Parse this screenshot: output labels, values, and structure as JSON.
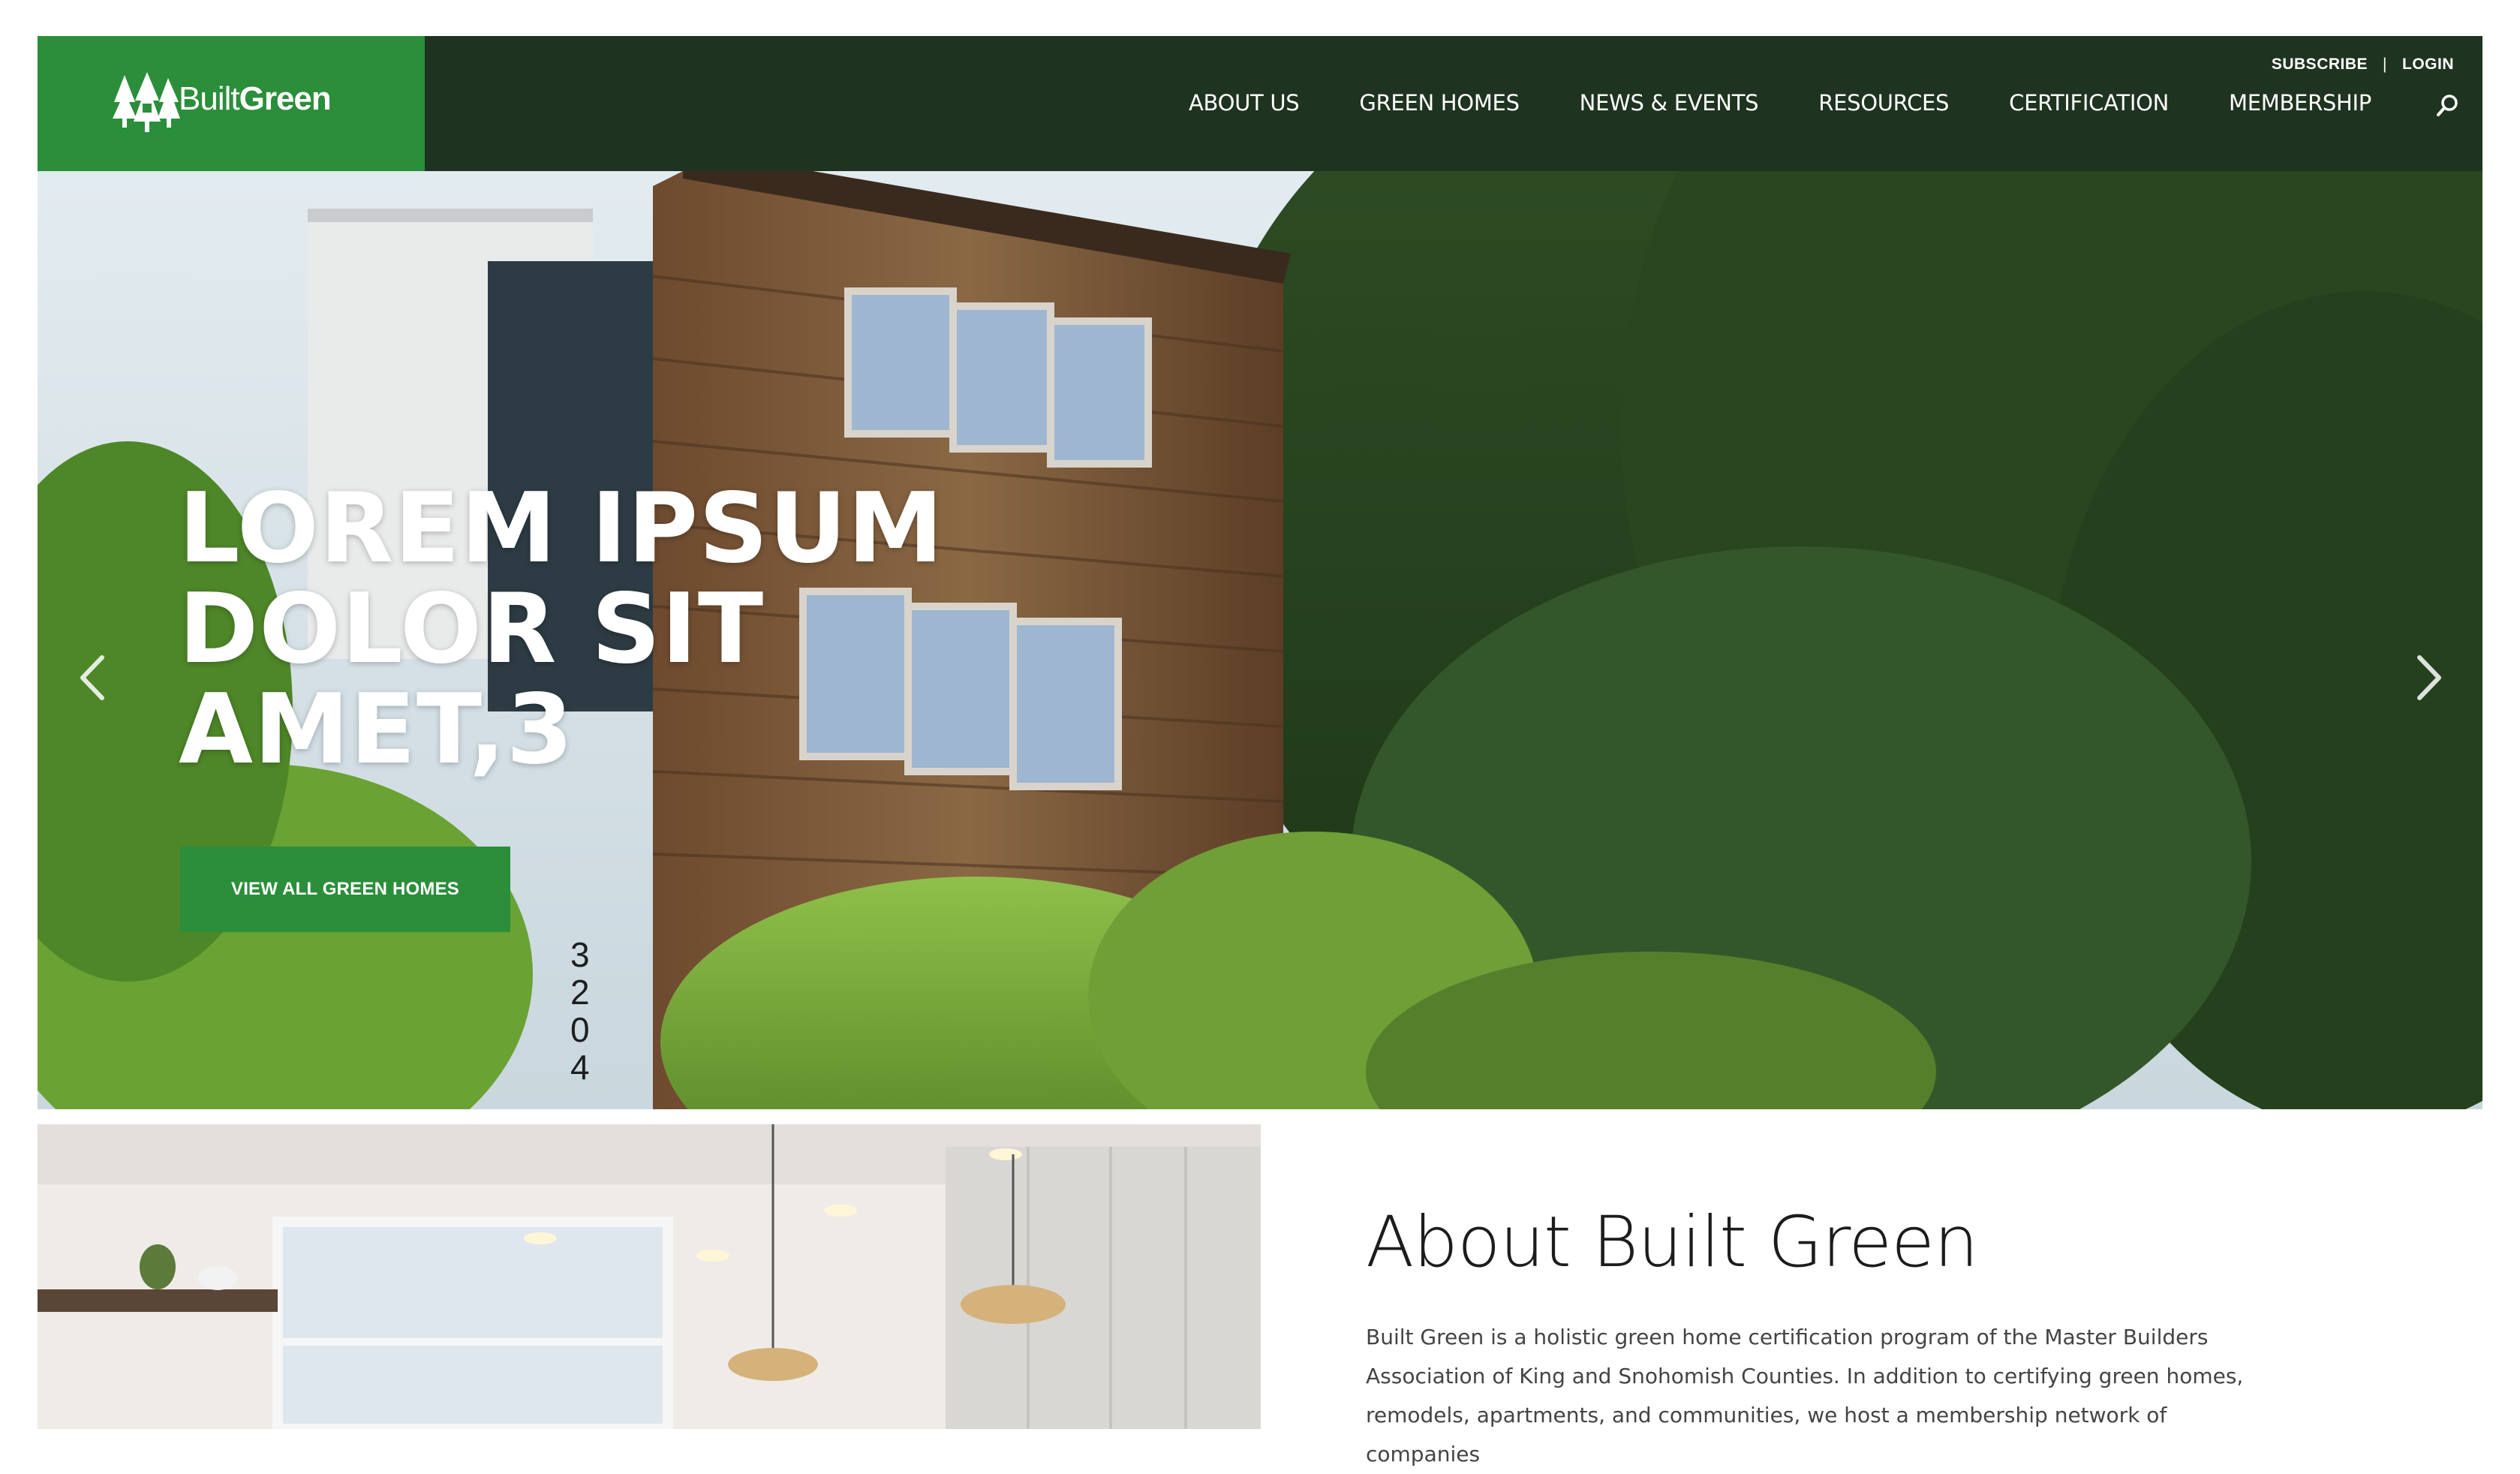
{
  "brand": {
    "name_part1": "Built",
    "name_part2": "Green",
    "green_color": "#2b8e3a",
    "header_color": "#1e3320"
  },
  "utility": {
    "subscribe": "SUBSCRIBE",
    "separator": "|",
    "login": "LOGIN"
  },
  "nav": {
    "items": [
      {
        "label": "ABOUT US"
      },
      {
        "label": "GREEN HOMES"
      },
      {
        "label": "NEWS & EVENTS"
      },
      {
        "label": "RESOURCES"
      },
      {
        "label": "CERTIFICATION"
      },
      {
        "label": "MEMBERSHIP"
      }
    ],
    "search_icon": "search-icon"
  },
  "hero": {
    "title_lines": [
      "LOREM IPSUM",
      "DOLOR SIT",
      "AMET,3"
    ],
    "cta_label": "VIEW ALL GREEN HOMES",
    "house_number": "3204",
    "prev_icon": "chevron-left-icon",
    "next_icon": "chevron-right-icon"
  },
  "about": {
    "heading": "About Built Green",
    "body": "Built Green is a holistic green home certification program of the Master Builders Association of King and Snohomish Counties. In addition to certifying green homes, remodels, apartments, and communities, we host a membership network of companies"
  }
}
